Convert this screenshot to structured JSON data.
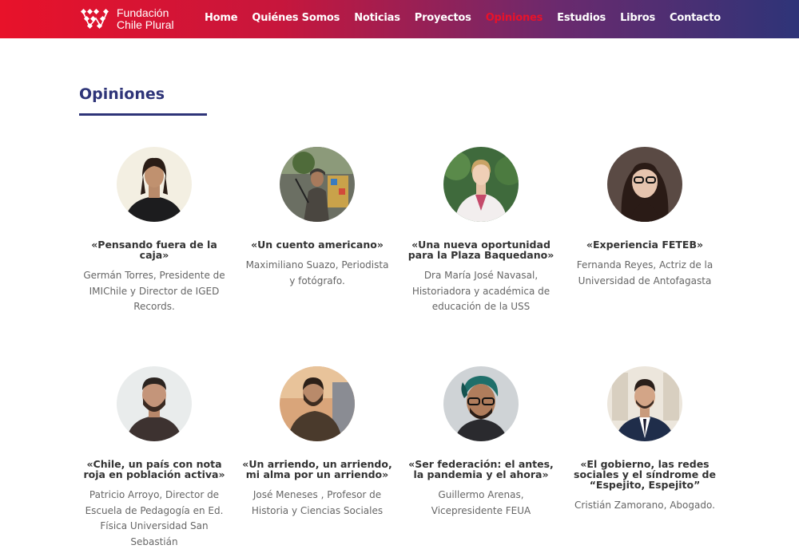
{
  "brand": {
    "line1": "Fundación",
    "line2": "Chile Plural",
    "colors": {
      "red": "#e8122a",
      "navy": "#2e3478"
    }
  },
  "nav": {
    "items": [
      "Home",
      "Quiénes Somos",
      "Noticias",
      "Proyectos",
      "Opiniones",
      "Estudios",
      "Libros",
      "Contacto"
    ],
    "active": "Opiniones"
  },
  "page": {
    "title": "Opiniones"
  },
  "cards": [
    {
      "title": "«Pensando fuera de la caja»",
      "author": "Germán Torres, Presidente de IMIChile y Director de IGED Records."
    },
    {
      "title": "«Un cuento americano»",
      "author": "Maximiliano Suazo, Periodista y fotógrafo."
    },
    {
      "title": "«Una nueva oportunidad para la Plaza Baquedano»",
      "author": "Dra María José Navasal, Historiadora y académica de educación de la USS"
    },
    {
      "title": "«Experiencia FETEB»",
      "author": "Fernanda Reyes, Actriz de la Universidad de Antofagasta"
    },
    {
      "title": "«Chile, un país con nota roja en población activa»",
      "author": "Patricio Arroyo, Director de Escuela de Pedagogía en Ed. Física Universidad San Sebastián"
    },
    {
      "title": "«Un arriendo, un arriendo, mi alma por un arriendo»",
      "author": "José Meneses , Profesor de Historia y Ciencias Sociales"
    },
    {
      "title": "«Ser federación: el antes, la pandemia y el ahora»",
      "author": "Guillermo Arenas, Vicepresidente FEUA"
    },
    {
      "title": "«El gobierno, las redes sociales y el síndrome de “Espejito, Espejito”",
      "author": "Cristián Zamorano, Abogado."
    }
  ]
}
